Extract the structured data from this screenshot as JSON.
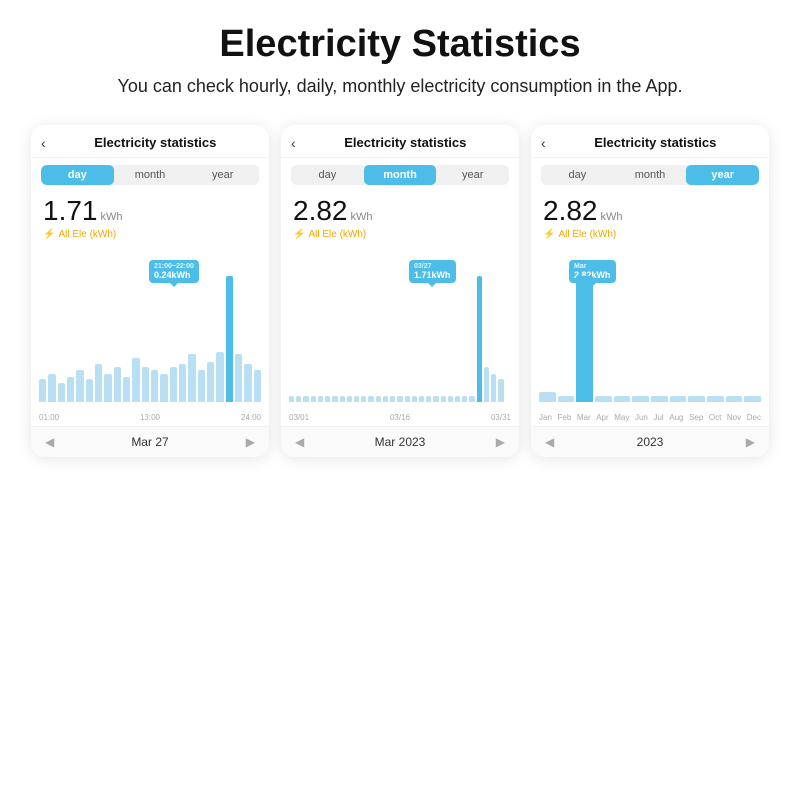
{
  "header": {
    "title": "Electricity Statistics",
    "subtitle": "You can check hourly, daily, monthly electricity consumption in the App."
  },
  "phones": [
    {
      "id": "day",
      "title": "Electricity statistics",
      "tabs": [
        "day",
        "month",
        "year"
      ],
      "active_tab": "day",
      "value": "1.71",
      "unit": "kWh",
      "label": "All Ele (kWh)",
      "tooltip": "0.24kWh",
      "tooltip_label": "21:00~22:00",
      "nav_label": "Mar 27",
      "x_labels": [
        "01:00",
        "13:00",
        "24:00"
      ]
    },
    {
      "id": "month",
      "title": "Electricity statistics",
      "tabs": [
        "day",
        "month",
        "year"
      ],
      "active_tab": "month",
      "value": "2.82",
      "unit": "kWh",
      "label": "All Ele (kWh)",
      "tooltip": "1.71kWh",
      "tooltip_label": "03/27",
      "nav_label": "Mar 2023",
      "x_labels": [
        "03/01",
        "03/16",
        "03/31"
      ]
    },
    {
      "id": "year",
      "title": "Electricity statistics",
      "tabs": [
        "day",
        "month",
        "year"
      ],
      "active_tab": "year",
      "value": "2.82",
      "unit": "kWh",
      "label": "All Ele (kWh)",
      "tooltip": "2.82kWh",
      "tooltip_label": "Mar",
      "nav_label": "2023",
      "x_labels": [
        "Jan",
        "Feb",
        "Mar",
        "Apr",
        "May",
        "Jun",
        "Jul",
        "Aug",
        "Sep",
        "Oct",
        "Nov",
        "Dec"
      ]
    }
  ]
}
